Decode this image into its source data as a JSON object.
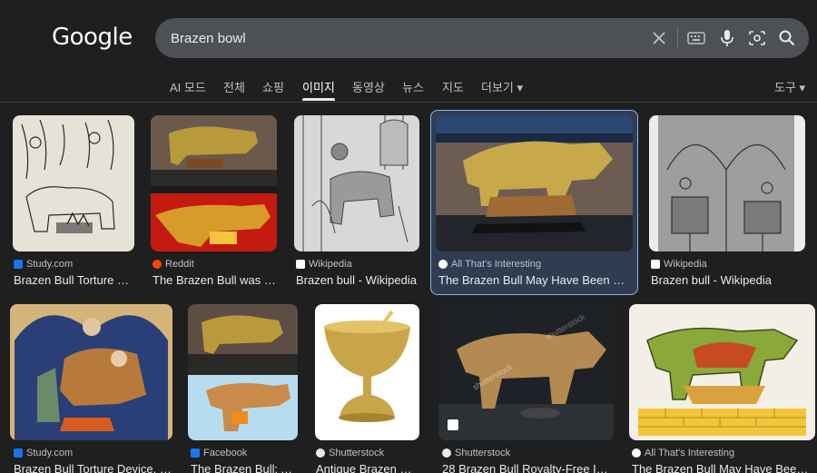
{
  "logo": "Google",
  "search": {
    "query": "Brazen bowl"
  },
  "tabs": [
    "AI 모드",
    "전체",
    "쇼핑",
    "이미지",
    "동영상",
    "뉴스",
    "지도",
    "더보기 ▾"
  ],
  "tools": "도구 ▾",
  "results": [
    {
      "source": "Study.com",
      "title": "Brazen Bull Torture D...",
      "fav_color": "#1a73e8"
    },
    {
      "source": "Reddit",
      "title": "The Brazen Bull was a...",
      "fav_color": "#ff4500"
    },
    {
      "source": "Wikipedia",
      "title": "Brazen bull - Wikipedia",
      "fav_color": "#ffffff"
    },
    {
      "source": "All That's Interesting",
      "title": "The Brazen Bull May Have Been His...",
      "fav_color": "#ffffff"
    },
    {
      "source": "Wikipedia",
      "title": "Brazen bull - Wikipedia",
      "fav_color": "#ffffff"
    },
    {
      "source": "Study.com",
      "title": "Brazen Bull Torture Device, I...",
      "fav_color": "#1a73e8"
    },
    {
      "source": "Facebook",
      "title": "The Brazen Bull: A...",
      "fav_color": "#1877f2"
    },
    {
      "source": "Shutterstock",
      "title": "Antique Brazen Ri...",
      "fav_color": "#e8eaed"
    },
    {
      "source": "Shutterstock",
      "title": "28 Brazen Bull Royalty-Free Ima...",
      "fav_color": "#e8eaed"
    },
    {
      "source": "All That's Interesting",
      "title": "The Brazen Bull May Have Been ...",
      "fav_color": "#ffffff"
    }
  ],
  "watermark": "shutterstock"
}
